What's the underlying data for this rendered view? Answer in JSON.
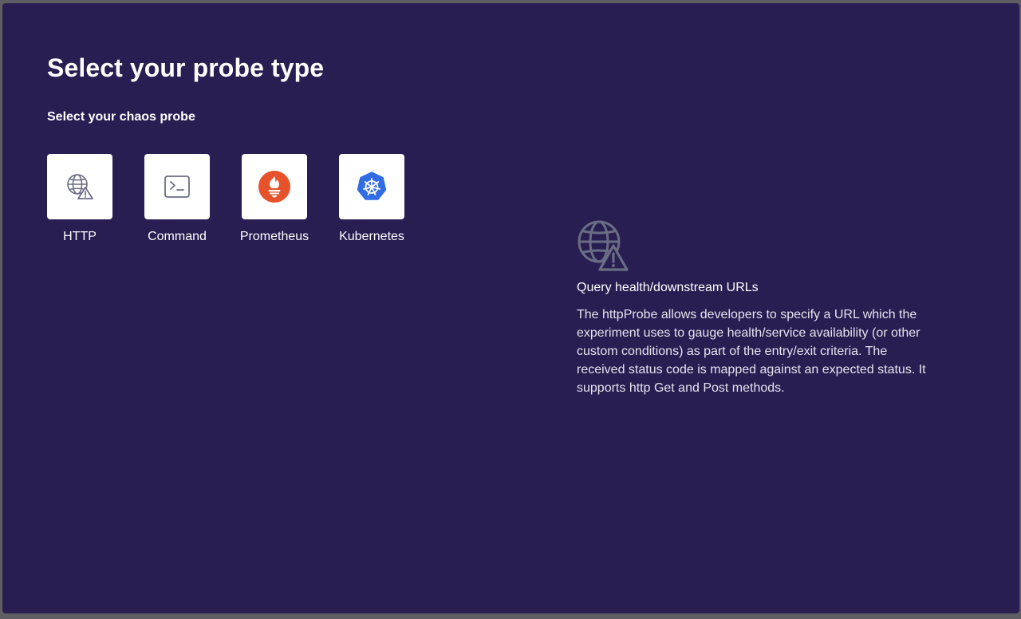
{
  "header": {
    "title": "Select your probe type",
    "subtitle": "Select your chaos probe"
  },
  "probes": [
    {
      "label": "HTTP",
      "icon": "globe-warning-icon"
    },
    {
      "label": "Command",
      "icon": "terminal-icon"
    },
    {
      "label": "Prometheus",
      "icon": "prometheus-icon"
    },
    {
      "label": "Kubernetes",
      "icon": "kubernetes-icon"
    }
  ],
  "detail": {
    "icon": "globe-warning-icon",
    "heading": "Query health/downstream URLs",
    "description": "The httpProbe allows developers to specify a URL which the experiment uses to gauge health/service availability (or other custom conditions) as part of the entry/exit criteria. The received status code is mapped against an expected status. It supports http Get and Post methods."
  },
  "colors": {
    "modal_background": "#281e52",
    "prometheus_orange": "#e6522c",
    "kubernetes_blue": "#326ce5",
    "icon_gray": "#6b6d85"
  }
}
